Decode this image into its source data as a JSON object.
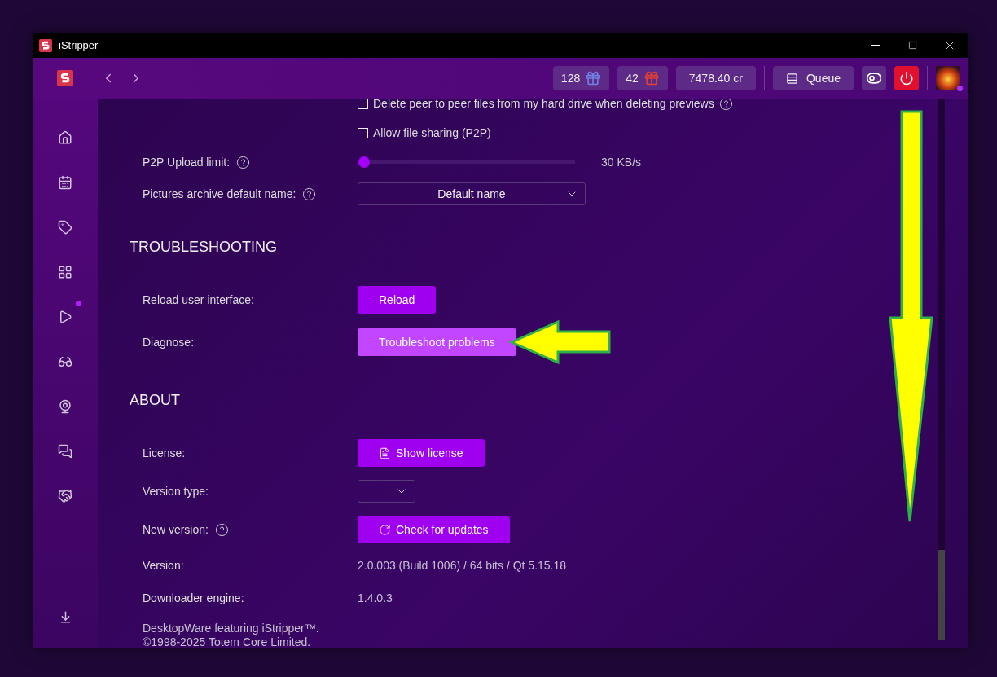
{
  "window": {
    "title": "iStripper"
  },
  "header": {
    "counters": [
      {
        "value": "128",
        "kind": "blue-gift"
      },
      {
        "value": "42",
        "kind": "red-gift"
      }
    ],
    "credits": "7478.40 cr",
    "queue": "Queue",
    "avatar_online": true
  },
  "sidebar": {
    "items": [
      {
        "kind": "home",
        "notification": false
      },
      {
        "kind": "calendar",
        "notification": false
      },
      {
        "kind": "tag",
        "notification": false
      },
      {
        "kind": "grid",
        "notification": false
      },
      {
        "kind": "play",
        "notification": true
      },
      {
        "kind": "vr",
        "notification": false
      },
      {
        "kind": "webcam",
        "notification": false
      },
      {
        "kind": "chat",
        "notification": false
      },
      {
        "kind": "handshake",
        "notification": false
      }
    ],
    "bottom": {
      "kind": "download"
    }
  },
  "settings": [
    {
      "kind": "checkbox",
      "label": "Delete peer to peer files from my hard drive when deleting previews",
      "checked": false,
      "help": true
    },
    {
      "kind": "checkbox",
      "label": "Allow file sharing (P2P)",
      "checked": false,
      "help": false
    },
    {
      "kind": "slider",
      "label": "P2P Upload limit:",
      "help": true,
      "level": 0.03,
      "reading": "30 KB/s"
    },
    {
      "kind": "dropdown",
      "label": "Pictures archive default name:",
      "help": true,
      "value": "Default name"
    }
  ],
  "sections": [
    {
      "title": "TROUBLESHOOTING",
      "rows": [
        {
          "kind": "button",
          "label": "Reload user interface:",
          "help": false,
          "button": "Reload",
          "hovered": false
        },
        {
          "kind": "button",
          "label": "Diagnose:",
          "help": false,
          "button": "Troubleshoot problems",
          "hovered": true
        }
      ]
    },
    {
      "title": "ABOUT",
      "rows": [
        {
          "kind": "doc-button",
          "label": "License:",
          "help": false,
          "button": "Show license",
          "hovered": false
        },
        {
          "kind": "empty-dropdown",
          "label": "Version type:",
          "help": false
        },
        {
          "kind": "refresh-button",
          "label": "New version:",
          "help": true,
          "button": "Check for updates",
          "hovered": false
        },
        {
          "kind": "text",
          "label": "Version:",
          "help": false,
          "value": "2.0.003 (Build 1006) / 64 bits / Qt 5.15.18"
        },
        {
          "kind": "text",
          "label": "Downloader engine:",
          "help": false,
          "value": "1.4.0.3"
        }
      ]
    }
  ],
  "footer": [
    "DesktopWare featuring iStripper™.",
    "©1998-2025 Totem Core Limited."
  ]
}
